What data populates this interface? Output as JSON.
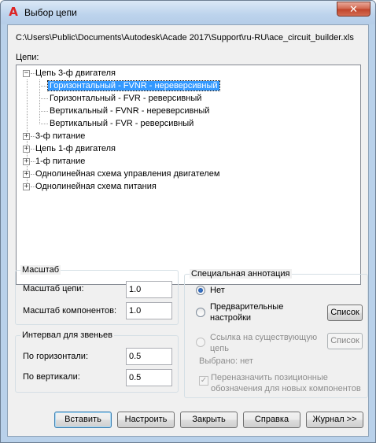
{
  "window": {
    "title": "Выбор цепи",
    "close_glyph": "✕"
  },
  "path": "C:\\Users\\Public\\Documents\\Autodesk\\Acade 2017\\Support\\ru-RU\\ace_circuit_builder.xls",
  "tree": {
    "label": "Цепи:",
    "items": [
      {
        "label": "Цепь 3-ф двигателя",
        "expander": "−"
      },
      {
        "label": "Горизонтальный - FVNR - нереверсивный"
      },
      {
        "label": "Горизонтальный - FVR - реверсивный"
      },
      {
        "label": "Вертикальный - FVNR - нереверсивный"
      },
      {
        "label": "Вертикальный - FVR - реверсивный"
      },
      {
        "label": "3-ф питание",
        "expander": "+"
      },
      {
        "label": "Цепь 1-ф двигателя",
        "expander": "+"
      },
      {
        "label": "1-ф питание",
        "expander": "+"
      },
      {
        "label": "Однолинейная схема управления двигателем",
        "expander": "+"
      },
      {
        "label": "Однолинейная схема питания",
        "expander": "+"
      }
    ]
  },
  "scale": {
    "title": "Масштаб",
    "circuit_label": "Масштаб цепи:",
    "circuit_value": "1.0",
    "component_label": "Масштаб компонентов:",
    "component_value": "1.0"
  },
  "spacing": {
    "title": "Интервал для звеньев",
    "horizontal_label": "По горизонтали:",
    "horizontal_value": "0.5",
    "vertical_label": "По вертикали:",
    "vertical_value": "0.5"
  },
  "annotation": {
    "title": "Специальная аннотация",
    "none_label": "Нет",
    "presets_label_line1": "Предварительные",
    "presets_label_line2": "настройки",
    "presets_list_button": "Список",
    "ref_label_line1": "Ссылка на существующую",
    "ref_label_line2": "цепь",
    "ref_list_button": "Список",
    "selected_text": "Выбрано: нет",
    "reassign_line1": "Переназначить позиционные",
    "reassign_line2": "обозначения для новых компонентов",
    "check_glyph": "✓"
  },
  "buttons": {
    "insert": "Вставить",
    "configure": "Настроить",
    "close": "Закрыть",
    "help": "Справка",
    "log": "Журнал >>"
  }
}
